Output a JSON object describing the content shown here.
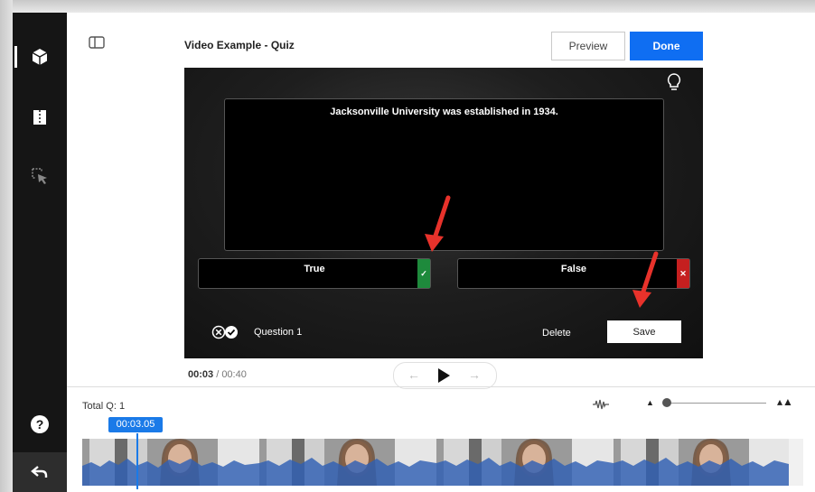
{
  "sidebar": {
    "items": [
      {
        "icon": "cube-icon",
        "active": true
      },
      {
        "icon": "split-frame-icon",
        "active": false
      },
      {
        "icon": "cursor-select-icon",
        "active": false
      }
    ],
    "help_icon": "help-icon",
    "back_icon": "back-arrow-icon"
  },
  "header": {
    "title": "Video Example - Quiz",
    "preview_label": "Preview",
    "done_label": "Done"
  },
  "quiz": {
    "question_text": "Jacksonville University was established in 1934.",
    "answers": [
      {
        "label": "True",
        "mark": "✓",
        "color": "#1e8a3c"
      },
      {
        "label": "False",
        "mark": "✕",
        "color": "#c51f1f"
      }
    ],
    "question_label": "Question 1",
    "delete_label": "Delete",
    "save_label": "Save"
  },
  "playback": {
    "current": "00:03",
    "separator": " / ",
    "duration": "00:40"
  },
  "timeline": {
    "total_label": "Total Q: 1",
    "marker_time": "00:03.05"
  },
  "colors": {
    "accent": "#0f6ef2",
    "annotation_arrow": "#e8322b",
    "waveform": "#2f5fb3"
  }
}
